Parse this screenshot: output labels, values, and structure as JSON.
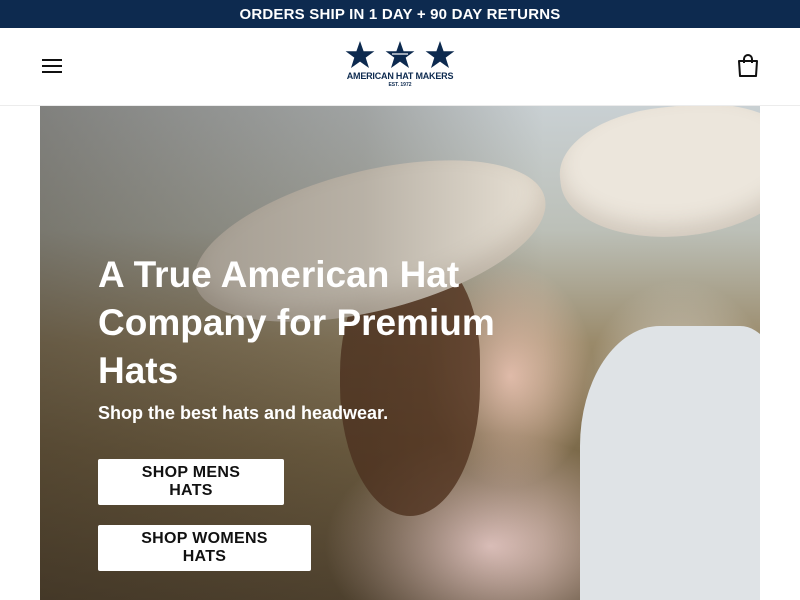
{
  "announcement": {
    "text": "ORDERS SHIP IN 1 DAY + 90 DAY RETURNS"
  },
  "header": {
    "menu_icon": "hamburger-menu-icon",
    "logo": {
      "name": "AMERICAN HAT MAKERS",
      "established": "EST. 1972",
      "icon": "three-stars-icon"
    },
    "cart_icon": "shopping-bag-icon"
  },
  "hero": {
    "title": "A True American Hat Company for Premium Hats",
    "subtitle": "Shop the best hats and headwear.",
    "buttons": {
      "mens": "SHOP MENS HATS",
      "womens": "SHOP WOMENS HATS"
    }
  },
  "colors": {
    "navy": "#0d2a4f",
    "white": "#ffffff",
    "text_dark": "#111111"
  }
}
